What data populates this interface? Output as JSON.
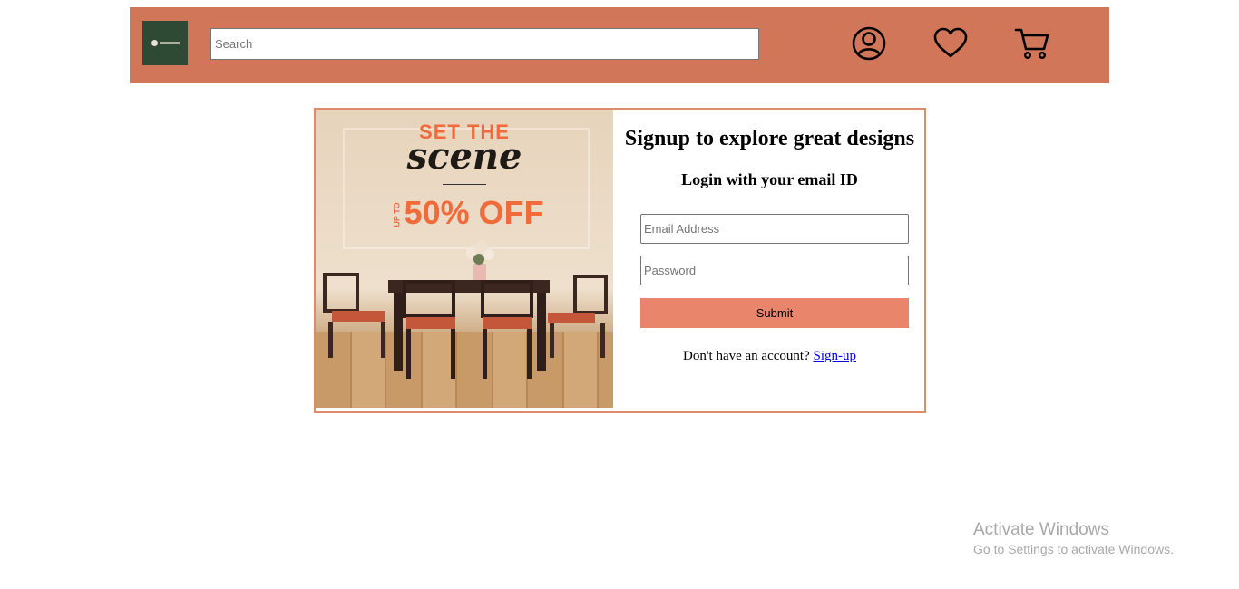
{
  "header": {
    "background": "#d17658",
    "search": {
      "placeholder": "Search",
      "value": ""
    },
    "icons": [
      "user-icon",
      "heart-icon",
      "cart-icon"
    ]
  },
  "promo": {
    "line1": "SET THE",
    "line2": "scene",
    "prefix": "UP TO",
    "line3": "50% OFF"
  },
  "form": {
    "title": "Signup to explore great designs",
    "subtitle": "Login with your email ID",
    "email_placeholder": "Email Address",
    "password_placeholder": "Password",
    "submit_label": "Submit",
    "account_prompt": "Don't have an account?",
    "signup_link": "Sign-up"
  },
  "watermark": {
    "title": "Activate Windows",
    "subtitle": "Go to Settings to activate Windows."
  },
  "colors": {
    "accent": "#e8856a",
    "border": "#e08a6c",
    "logo_bg": "#2f4a34"
  }
}
